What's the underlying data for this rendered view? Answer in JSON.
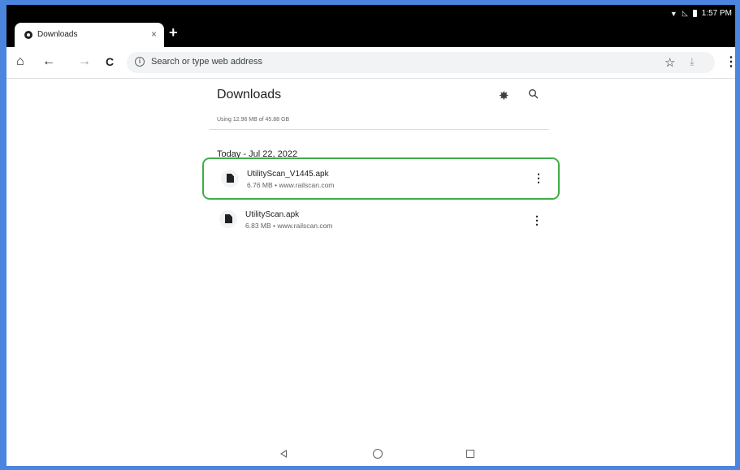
{
  "status_bar": {
    "time": "1:57 PM"
  },
  "tab": {
    "title": "Downloads",
    "close_glyph": "×"
  },
  "new_tab_glyph": "+",
  "toolbar": {
    "home_glyph": "⌂",
    "back_glyph": "←",
    "forward_glyph": "→",
    "reload_glyph": "C",
    "address_placeholder": "Search or type web address",
    "star_glyph": "☆",
    "download_glyph": "⤓",
    "menu_glyph": "⋮"
  },
  "downloads": {
    "title": "Downloads",
    "storage_usage": "Using 12.96 MB of 45.88 GB",
    "date_header": "Today - Jul 22, 2022",
    "items": [
      {
        "name": "UtilityScan_V1445.apk",
        "meta": "6.76 MB • www.railscan.com",
        "highlighted": true
      },
      {
        "name": "UtilityScan.apk",
        "meta": "6.83 MB • www.railscan.com",
        "highlighted": false
      }
    ],
    "more_glyph": "⋮"
  },
  "icons": {
    "favicon": "chrome-icon",
    "settings": "gear-icon",
    "search": "search-icon",
    "file": "file-icon"
  },
  "colors": {
    "highlight": "#3fae49",
    "frame": "#4a86e0"
  }
}
